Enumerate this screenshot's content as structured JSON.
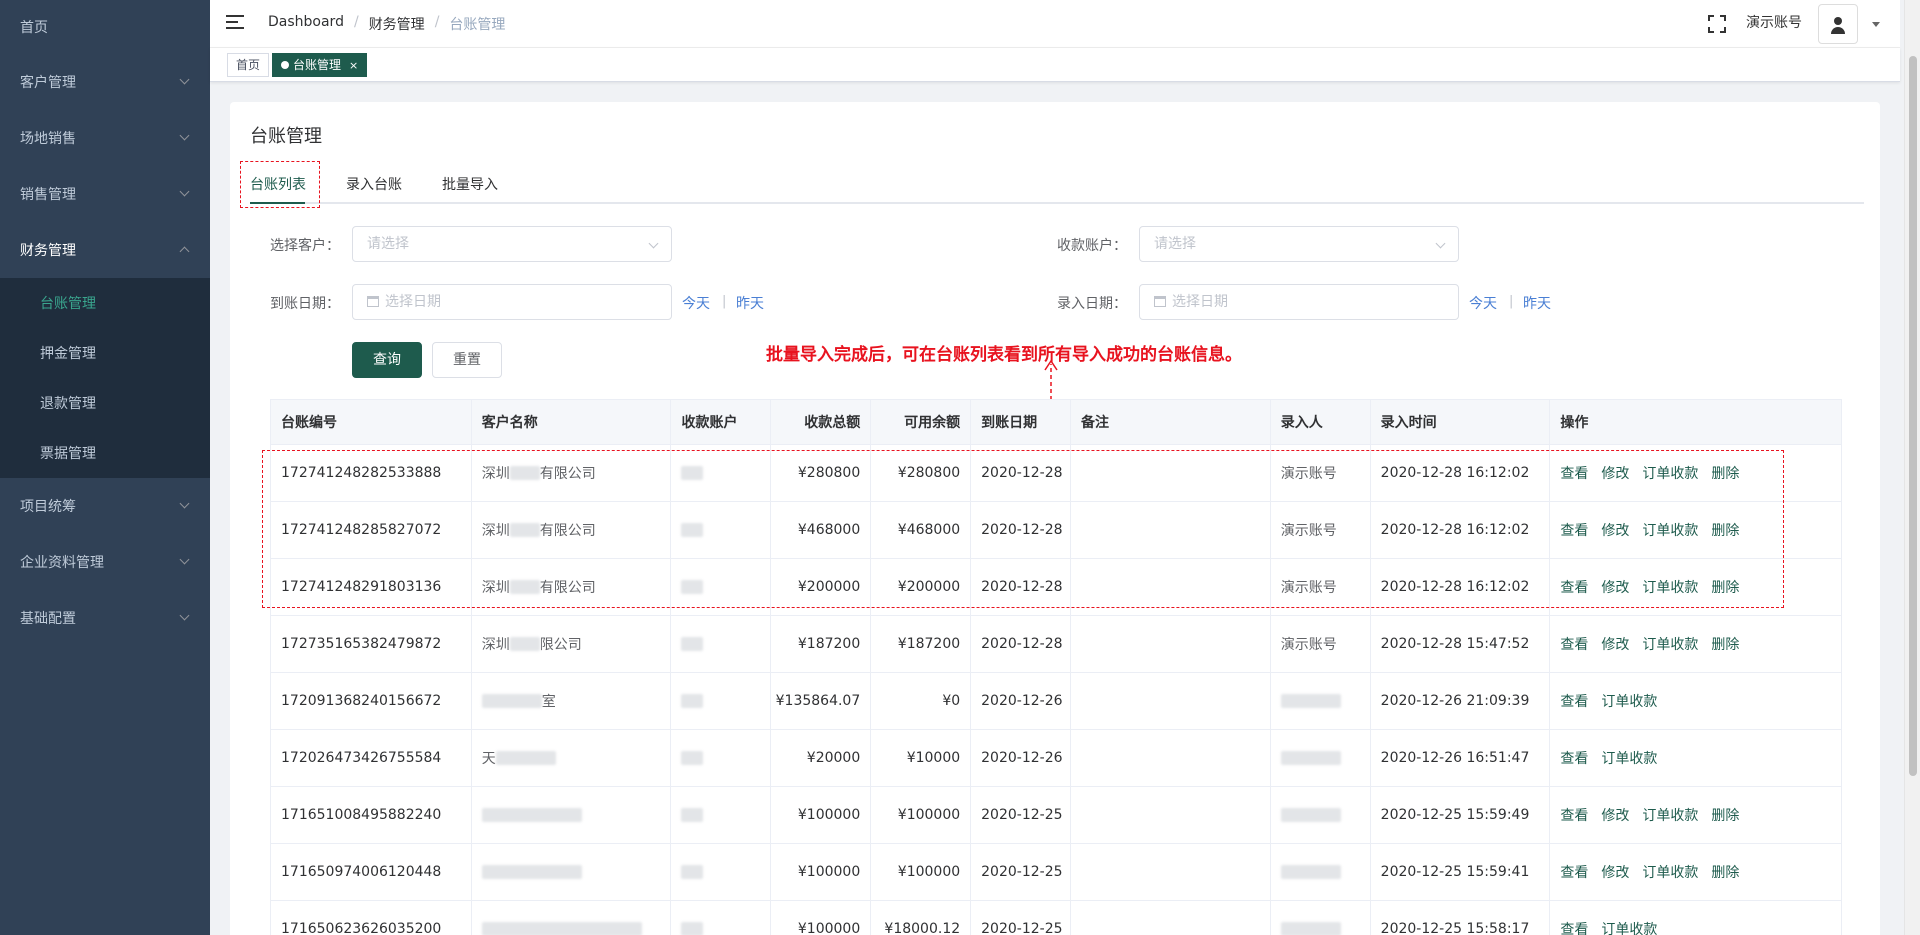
{
  "sidebar": {
    "items": [
      {
        "label": "首页"
      },
      {
        "label": "客户管理"
      },
      {
        "label": "场地销售"
      },
      {
        "label": "销售管理"
      },
      {
        "label": "财务管理"
      },
      {
        "label": "项目统筹"
      },
      {
        "label": "企业资料管理"
      },
      {
        "label": "基础配置"
      }
    ],
    "finance_sub": [
      {
        "label": "台账管理"
      },
      {
        "label": "押金管理"
      },
      {
        "label": "退款管理"
      },
      {
        "label": "票据管理"
      }
    ]
  },
  "header": {
    "breadcrumb": [
      "Dashboard",
      "财务管理",
      "台账管理"
    ],
    "account": "演示账号"
  },
  "tags": {
    "home": "首页",
    "current": "台账管理",
    "close": "×"
  },
  "page": {
    "title": "台账管理",
    "tabs": [
      "台账列表",
      "录入台账",
      "批量导入"
    ]
  },
  "form": {
    "customer_label": "选择客户：",
    "customer_placeholder": "请选择",
    "account_label": "收款账户：",
    "account_placeholder": "请选择",
    "arrival_label": "到账日期：",
    "arrival_placeholder": "选择日期",
    "entry_label": "录入日期：",
    "entry_placeholder": "选择日期",
    "today": "今天",
    "yesterday": "昨天",
    "sep": "|",
    "query": "查询",
    "reset": "重置"
  },
  "annotation": "批量导入完成后，可在台账列表看到所有导入成功的台账信息。",
  "table": {
    "headers": [
      "台账编号",
      "客户名称",
      "收款账户",
      "收款总额",
      "可用余额",
      "到账日期",
      "备注",
      "录入人",
      "录入时间",
      "操作"
    ],
    "rows": [
      {
        "id": "172741248282533888",
        "cust_a": "深圳",
        "cust_b": "有限公司",
        "acct": "",
        "total": "¥280800",
        "avail": "¥280800",
        "date": "2020-12-28",
        "note": "",
        "entry": "演示账号",
        "time": "2020-12-28 16:12:02",
        "ops": [
          "查看",
          "修改",
          "订单收款",
          "删除"
        ]
      },
      {
        "id": "172741248285827072",
        "cust_a": "深圳",
        "cust_b": "有限公司",
        "acct": "",
        "total": "¥468000",
        "avail": "¥468000",
        "date": "2020-12-28",
        "note": "",
        "entry": "演示账号",
        "time": "2020-12-28 16:12:02",
        "ops": [
          "查看",
          "修改",
          "订单收款",
          "删除"
        ]
      },
      {
        "id": "172741248291803136",
        "cust_a": "深圳",
        "cust_b": "有限公司",
        "acct": "",
        "total": "¥200000",
        "avail": "¥200000",
        "date": "2020-12-28",
        "note": "",
        "entry": "演示账号",
        "time": "2020-12-28 16:12:02",
        "ops": [
          "查看",
          "修改",
          "订单收款",
          "删除"
        ]
      },
      {
        "id": "172735165382479872",
        "cust_a": "深圳",
        "cust_b": "限公司",
        "acct": "",
        "total": "¥187200",
        "avail": "¥187200",
        "date": "2020-12-28",
        "note": "",
        "entry": "演示账号",
        "time": "2020-12-28 15:47:52",
        "ops": [
          "查看",
          "修改",
          "订单收款",
          "删除"
        ]
      },
      {
        "id": "172091368240156672",
        "cust_a": "",
        "cust_b": "室",
        "acct": "",
        "total": "¥135864.07",
        "avail": "¥0",
        "date": "2020-12-26",
        "note": "",
        "entry": "",
        "time": "2020-12-26 21:09:39",
        "ops": [
          "查看",
          "订单收款"
        ]
      },
      {
        "id": "172026473426755584",
        "cust_a": "天",
        "cust_b": "",
        "acct": "",
        "total": "¥20000",
        "avail": "¥10000",
        "date": "2020-12-26",
        "note": "",
        "entry": "",
        "time": "2020-12-26 16:51:47",
        "ops": [
          "查看",
          "订单收款"
        ]
      },
      {
        "id": "171651008495882240",
        "cust_a": "",
        "cust_b": "",
        "acct": "",
        "total": "¥100000",
        "avail": "¥100000",
        "date": "2020-12-25",
        "note": "",
        "entry": "",
        "time": "2020-12-25 15:59:49",
        "ops": [
          "查看",
          "修改",
          "订单收款",
          "删除"
        ]
      },
      {
        "id": "171650974006120448",
        "cust_a": "",
        "cust_b": "",
        "acct": "",
        "total": "¥100000",
        "avail": "¥100000",
        "date": "2020-12-25",
        "note": "",
        "entry": "",
        "time": "2020-12-25 15:59:41",
        "ops": [
          "查看",
          "修改",
          "订单收款",
          "删除"
        ]
      },
      {
        "id": "171650623626035200",
        "cust_a": "",
        "cust_b": "",
        "acct": "",
        "total": "¥100000",
        "avail": "¥18000.12",
        "date": "2020-12-25",
        "note": "",
        "entry": "",
        "time": "2020-12-25 15:58:17",
        "ops": [
          "查看",
          "订单收款"
        ]
      }
    ]
  },
  "colors": {
    "primary": "#1e5b4d",
    "sidebar_bg": "#304156",
    "annotation": "#e8131f",
    "link": "#4a7fd4"
  }
}
